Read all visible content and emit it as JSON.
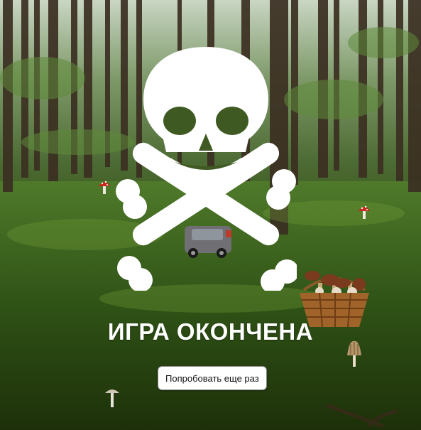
{
  "game": {
    "status_title": "ИГРА ОКОНЧЕНА",
    "retry_button_label": "Попробовать еще раз"
  },
  "icons": {
    "status_icon": "skull-crossbones-icon",
    "player": "car-icon",
    "collectibles": [
      "amanita-mushroom-icon",
      "amanita-mushroom-icon",
      "mushroom-basket-icon",
      "morel-mushroom-icon",
      "white-mushroom-icon"
    ]
  },
  "colors": {
    "title_text": "#ffffff",
    "skull": "#ffffff",
    "button_bg": "#ffffff"
  }
}
